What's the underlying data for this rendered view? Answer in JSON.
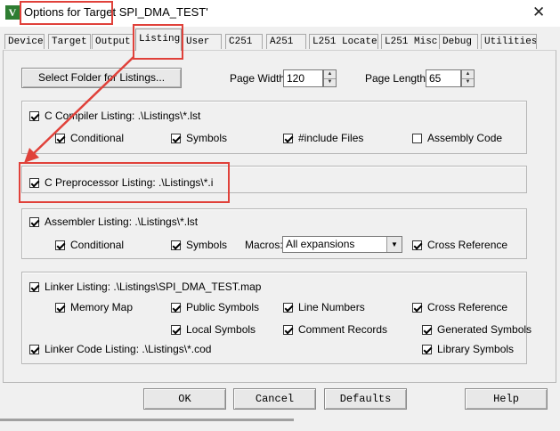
{
  "window": {
    "title_prefix": "Options for Target",
    "title_name": " SPI_DMA_TEST'",
    "app_icon": "V",
    "close_glyph": "✕"
  },
  "tabs": [
    "Device",
    "Target",
    "Output",
    "Listing",
    "User",
    "C251",
    "A251",
    "L251 Locate",
    "L251 Misc",
    "Debug",
    "Utilities"
  ],
  "top": {
    "select_folder_label": "Select Folder for Listings...",
    "page_width_label": "Page Width:",
    "page_width_value": "120",
    "page_length_label": "Page Length:",
    "page_length_value": "65"
  },
  "compiler": {
    "title": "C Compiler Listing:  .\\Listings\\*.lst",
    "conditional": "Conditional",
    "symbols": "Symbols",
    "include_files": "#include Files",
    "assembly_code": "Assembly Code"
  },
  "preprocessor": {
    "title": "C Preprocessor Listing:  .\\Listings\\*.i"
  },
  "assembler": {
    "title": "Assembler Listing:  .\\Listings\\*.lst",
    "conditional": "Conditional",
    "symbols": "Symbols",
    "macros_label": "Macros:",
    "macros_value": "All expansions",
    "cross_reference": "Cross Reference"
  },
  "linker": {
    "title": "Linker Listing:  .\\Listings\\SPI_DMA_TEST.map",
    "memory_map": "Memory Map",
    "public_symbols": "Public Symbols",
    "line_numbers": "Line Numbers",
    "cross_reference": "Cross Reference",
    "local_symbols": "Local Symbols",
    "comment_records": "Comment Records",
    "generated_symbols": "Generated Symbols",
    "code_listing": "Linker Code Listing:  .\\Listings\\*.cod",
    "library_symbols": "Library Symbols"
  },
  "buttons": {
    "ok": "OK",
    "cancel": "Cancel",
    "defaults": "Defaults",
    "help": "Help"
  },
  "colors": {
    "highlight": "#e0413a",
    "window_bg": "#f0f0f0"
  }
}
